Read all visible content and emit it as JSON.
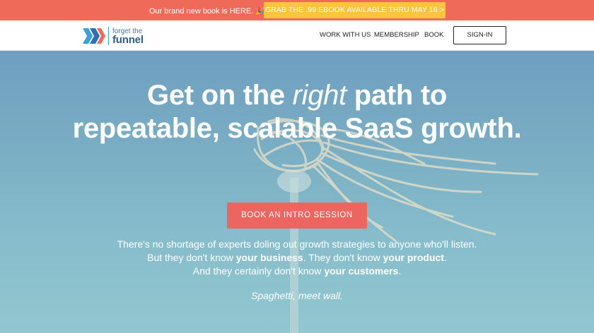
{
  "promo": {
    "text": "Our brand new book is HERE.",
    "emoji": "🎉",
    "button_label": "GRAB THE .99 EBOOK AVAILABLE THRU MAY 16 >"
  },
  "header": {
    "logo_top": "forget the",
    "logo_bottom": "funnel",
    "nav": [
      "WORK WITH US",
      "MEMBERSHIP",
      "BOOK"
    ],
    "signin_label": "SIGN-IN"
  },
  "hero": {
    "headline_part1": "Get on the",
    "headline_italic": "right",
    "headline_part2": "path to repeatable, scalable SaaS growth.",
    "cta_label": "BOOK AN INTRO SESSION",
    "line1": "There's no shortage of experts doling out growth strategies to anyone who'll listen.",
    "line2_a": "But they don't know",
    "line2_b": "your business",
    "line2_c": ". They don't know",
    "line2_d": "your product",
    "line2_e": ".",
    "line3_a": "And they certainly don't know",
    "line3_b": "your customers",
    "line3_c": ".",
    "tagline": "Spaghetti, meet wall."
  },
  "colors": {
    "promo_bg": "#f06a5a",
    "promo_button": "#fcc43f",
    "cta": "#ec6561",
    "logo_text": "#2c5e8f"
  }
}
